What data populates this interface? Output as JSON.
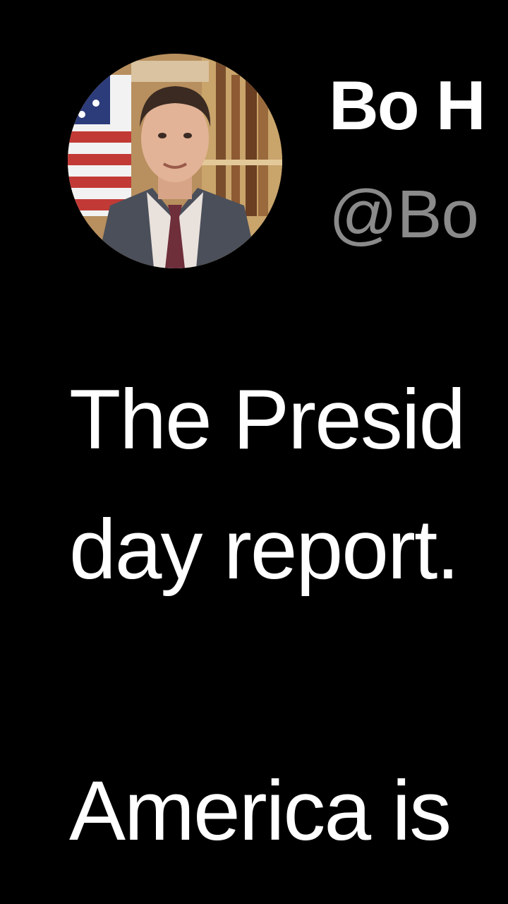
{
  "tweet": {
    "author": {
      "display_name": "Bo H",
      "handle": "@Bo",
      "avatar_icon": "profile-photo"
    },
    "text_lines": [
      "The Presid",
      "day report.",
      "America is"
    ]
  },
  "colors": {
    "background": "#000000",
    "primary_text": "#ffffff",
    "secondary_text": "#8a8a8a"
  }
}
